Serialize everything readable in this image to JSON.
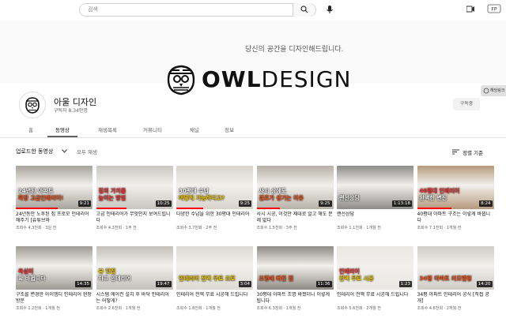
{
  "search": {
    "placeholder": "검색"
  },
  "banner": {
    "slogan": "당신의 공간을 디자인해드립니다.",
    "brand_bold": "OWL",
    "brand_light": "DESIGN",
    "link_label": "해당링크"
  },
  "channel": {
    "name": "아울 디자인",
    "subscribers": "구독자 8.34만명",
    "subscribe_label": "구독중"
  },
  "tabs": [
    {
      "label": "홈"
    },
    {
      "label": "동영상"
    },
    {
      "label": "재생목록"
    },
    {
      "label": "커뮤니티"
    },
    {
      "label": "채널"
    },
    {
      "label": "정보"
    }
  ],
  "filter": {
    "label": "업로드한 동영상",
    "play_all": "모두 재생",
    "sort": "정렬 기준"
  },
  "videos": [
    {
      "caption1": "24년된 아파트",
      "caption2": "확장 고급인테리어!",
      "duration": "9:21",
      "progress": 0.55,
      "title": "24년동안 노후된 집 프로모 인테리어 해주기 [유튜브와",
      "meta": "조회수 4.3천회 · 3일 전",
      "bg": "#a7a39c",
      "c1": "#ffffff",
      "c2": "#ff5a1e"
    },
    {
      "caption1": "집의 가치를",
      "caption2": "높이는 방법",
      "duration": "10:25",
      "progress": 0.4,
      "title": "고급 인테리어가 무엇인지 보여드립니다",
      "meta": "조회수 4.3천회 · 1주 전",
      "bg": "#c9c6c1",
      "c1": "#ff3b3b",
      "c2": "#ff3b3b"
    },
    {
      "caption1": "30평대 수납",
      "caption2": "어떻게 가능하다고?",
      "duration": "9:25",
      "progress": 0.35,
      "title": "다양한 수납을 위한 30평대 인테리어",
      "meta": "조회수 3.7천회 · 2주 전",
      "bg": "#d8d4cc",
      "c1": "#ffffff",
      "c2": "#ffd400"
    },
    {
      "caption1": "사시 상에도",
      "caption2": "결로가 생기는 이유",
      "duration": "9:25",
      "progress": 0.3,
      "title": "사시 시공, 이것만 제대로 알고 해도 문제 없다",
      "meta": "조회수 1.5천회 · 3주 전",
      "bg": "#b7b1a7",
      "c1": "#ffffff",
      "c2": "#ff5a1e"
    },
    {
      "caption1": "",
      "caption2": "랜선상담",
      "duration": "1:13:18",
      "progress": 0.0,
      "title": "랜선상담",
      "meta": "조회수 1.1천회 · 1개월 전",
      "bg": "#8d8c88",
      "c1": "#ffffff",
      "c2": "#ffffff"
    },
    {
      "caption1": "40평대 인테리어",
      "caption2": "완벽한 변신",
      "duration": "8:24",
      "progress": 0.45,
      "title": "40평대 아파트 구조는 이렇게 바뀝니다",
      "meta": "조회수 7.1천회 · 1개월 전",
      "bg": "#b59a7c",
      "c1": "#ff3b3b",
      "c2": "#ffffff"
    },
    {
      "caption1": "욕실이",
      "caption2": "확 바뀝니다",
      "duration": "14:35",
      "progress": 0.0,
      "title": "구조를 변경한 아이엠디 인테리어 현장 방문",
      "meta": "조회수 1.2천회 · 1개월 전",
      "bg": "#9e9a93",
      "c1": "#ff3b3b",
      "c2": "#ffffff"
    },
    {
      "caption1": "뷰 맛집",
      "caption2": "마크 인테리어",
      "duration": "19:47",
      "progress": 0.0,
      "title": "시스템 에어컨 설치 후 바닥 인테리어는 어떻게?",
      "meta": "조회수 2.6천회 · 1개월 전",
      "bg": "#c3c0ba",
      "c1": "#ffd400",
      "c2": "#ffffff"
    },
    {
      "caption1": "",
      "caption2": "인테리어 전액 무료 프로",
      "duration": "3:04",
      "progress": 0.0,
      "title": "인테리어 전액 무료 시공해 드립니다",
      "meta": "조회수 1.8천회 · 1개월 전",
      "bg": "#dddad4",
      "c1": "#ffffff",
      "c2": "#ffd400"
    },
    {
      "caption1": "",
      "caption2": "조명에 빠진 집",
      "duration": "11:36",
      "progress": 0.0,
      "title": "30평대 아파트 조명 바꿨더니 이렇게 됩니다",
      "meta": "조회수 6.3천회 · 1개월 전",
      "bg": "#8e8a83",
      "c1": "#ffffff",
      "c2": "#ff5a1e"
    },
    {
      "caption1": "인테리어",
      "caption2": "전액 무료 시공",
      "duration": "1:23",
      "progress": 0.0,
      "title": "인테리어 전액 무료 시공해 드립니다",
      "meta": "조회수 5.6천회 · 2개월 전",
      "bg": "#e9e7e2",
      "c1": "#ff3b3b",
      "c2": "#ffd400"
    },
    {
      "caption1": "",
      "caption2": "34평 아파트 리모델링",
      "duration": "14:20",
      "progress": 0.0,
      "title": "34평 아파트 인테리어 공식 [직접 공개]",
      "meta": "조회수 4.8천회 · 2개월 전",
      "bg": "#cfccc6",
      "c1": "#ffffff",
      "c2": "#ff5a1e"
    }
  ]
}
